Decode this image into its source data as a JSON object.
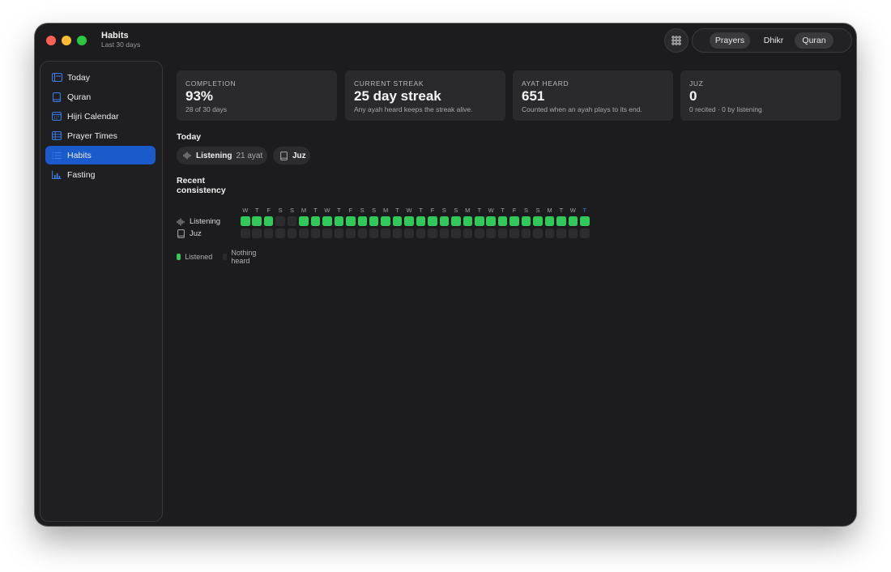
{
  "window": {
    "title": "Habits",
    "subtitle": "Last 30 days"
  },
  "toolbar": {
    "segments": [
      {
        "label": "Prayers",
        "active": true
      },
      {
        "label": "Dhikr",
        "active": false
      },
      {
        "label": "Quran",
        "active": true
      }
    ],
    "grid_icon": "grid-icon"
  },
  "sidebar": {
    "items": [
      {
        "label": "Today",
        "icon": "today-icon",
        "active": false
      },
      {
        "label": "Quran",
        "icon": "book-icon",
        "active": false
      },
      {
        "label": "Hijri Calendar",
        "icon": "calendar-icon",
        "active": false
      },
      {
        "label": "Prayer Times",
        "icon": "table-icon",
        "active": false
      },
      {
        "label": "Habits",
        "icon": "list-icon",
        "active": true
      },
      {
        "label": "Fasting",
        "icon": "chart-icon",
        "active": false
      }
    ]
  },
  "stats": [
    {
      "label": "COMPLETION",
      "value": "93%",
      "sub": "28 of 30 days"
    },
    {
      "label": "CURRENT STREAK",
      "value": "25 day streak",
      "sub": "Any ayah heard keeps the streak alive."
    },
    {
      "label": "AYAT HEARD",
      "value": "651",
      "sub": "Counted when an ayah plays to its end."
    },
    {
      "label": "JUZ",
      "value": "0",
      "sub": "0 recited · 0 by listening"
    }
  ],
  "today": {
    "title": "Today",
    "chips": [
      {
        "label": "Listening",
        "value": "21 ayat",
        "icon": "waveform-icon"
      },
      {
        "label": "Juz",
        "value": "",
        "icon": "book-icon"
      }
    ]
  },
  "consistency": {
    "title": "Recent consistency",
    "days": [
      "W",
      "T",
      "F",
      "S",
      "S",
      "M",
      "T",
      "W",
      "T",
      "F",
      "S",
      "S",
      "M",
      "T",
      "W",
      "T",
      "F",
      "S",
      "S",
      "M",
      "T",
      "W",
      "T",
      "F",
      "S",
      "S",
      "M",
      "T",
      "W",
      "T"
    ],
    "rows": [
      {
        "label": "Listening",
        "icon": "waveform-icon",
        "values": [
          1,
          1,
          1,
          0,
          0,
          1,
          1,
          1,
          1,
          1,
          1,
          1,
          1,
          1,
          1,
          1,
          1,
          1,
          1,
          1,
          1,
          1,
          1,
          1,
          1,
          1,
          1,
          1,
          1,
          1
        ]
      },
      {
        "label": "Juz",
        "icon": "book-icon",
        "values": [
          0,
          0,
          0,
          0,
          0,
          0,
          0,
          0,
          0,
          0,
          0,
          0,
          0,
          0,
          0,
          0,
          0,
          0,
          0,
          0,
          0,
          0,
          0,
          0,
          0,
          0,
          0,
          0,
          0,
          0
        ]
      }
    ],
    "legend": [
      {
        "label": "Listened",
        "color": "#30c95a"
      },
      {
        "label": "Nothing heard",
        "color": "#2c2c2e"
      }
    ],
    "today_color": "#2a7cf0",
    "filled_color": "#30c95a",
    "empty_color": "#2c2c2e"
  }
}
